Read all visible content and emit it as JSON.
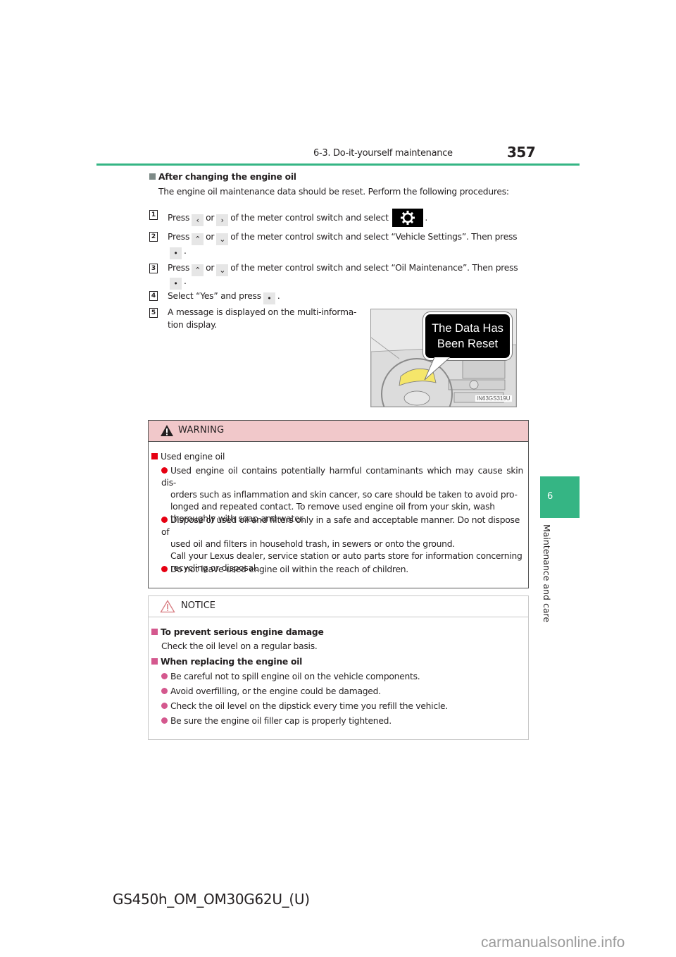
{
  "header": {
    "section_title": "6-3. Do-it-yourself maintenance",
    "page_number": "357",
    "accent_color": "#35b584"
  },
  "side_tab": {
    "chapter_number": "6",
    "chapter_label": "Maintenance and care"
  },
  "main": {
    "heading": "After changing the engine oil",
    "intro": "The engine oil maintenance data should be reset. Perform the following procedures:",
    "steps": [
      {
        "num": "1",
        "parts": [
          "Press",
          "or",
          "of the meter control switch and select",
          "."
        ],
        "keys": [
          "chevron-left",
          "chevron-right",
          "gear"
        ]
      },
      {
        "num": "2",
        "parts": [
          "Press",
          "or",
          "of the meter control switch and select “Vehicle Settings”. Then press",
          "."
        ],
        "keys": [
          "chevron-up",
          "chevron-down",
          "enter-dot"
        ]
      },
      {
        "num": "3",
        "parts": [
          "Press",
          "or",
          "of the meter control switch and select “Oil Maintenance”. Then press",
          "."
        ],
        "keys": [
          "chevron-up",
          "chevron-down",
          "enter-dot"
        ]
      },
      {
        "num": "4",
        "parts": [
          "Select “Yes” and press",
          "."
        ],
        "keys": [
          "enter-dot"
        ]
      },
      {
        "num": "5",
        "text_line1": "A message is displayed on the multi-informa-",
        "text_line2": "tion display."
      }
    ],
    "illustration": {
      "message_line1": "The Data Has",
      "message_line2": "Been Reset",
      "code": "IN63GS319U"
    }
  },
  "warning": {
    "title": "WARNING",
    "color": "#e60012",
    "heading": "Used engine oil",
    "items": [
      [
        "Used engine oil contains potentially harmful contaminants which may cause skin dis-",
        "orders such as inflammation and skin cancer, so care should be taken to avoid pro-",
        "longed and repeated contact. To remove used engine oil from your skin, wash",
        "thoroughly with soap and water."
      ],
      [
        "Dispose of used oil and filters only in a safe and acceptable manner. Do not dispose of",
        "used oil and filters in household trash, in sewers or onto the ground.",
        "Call your Lexus dealer, service station or auto parts store for information concerning",
        "recycling or disposal."
      ],
      [
        "Do not leave used engine oil within the reach of children."
      ]
    ]
  },
  "notice": {
    "title": "NOTICE",
    "color": "#d4588e",
    "sections": [
      {
        "heading": "To prevent serious engine damage",
        "text": "Check the oil level on a regular basis."
      },
      {
        "heading": "When replacing the engine oil",
        "items": [
          "Be careful not to spill engine oil on the vehicle components.",
          "Avoid overfilling, or the engine could be damaged.",
          "Check the oil level on the dipstick every time you refill the vehicle.",
          "Be sure the engine oil filler cap is properly tightened."
        ]
      }
    ]
  },
  "footer": {
    "model_code": "GS450h_OM_OM30G62U_(U)",
    "watermark": "carmanualsonline.info"
  }
}
